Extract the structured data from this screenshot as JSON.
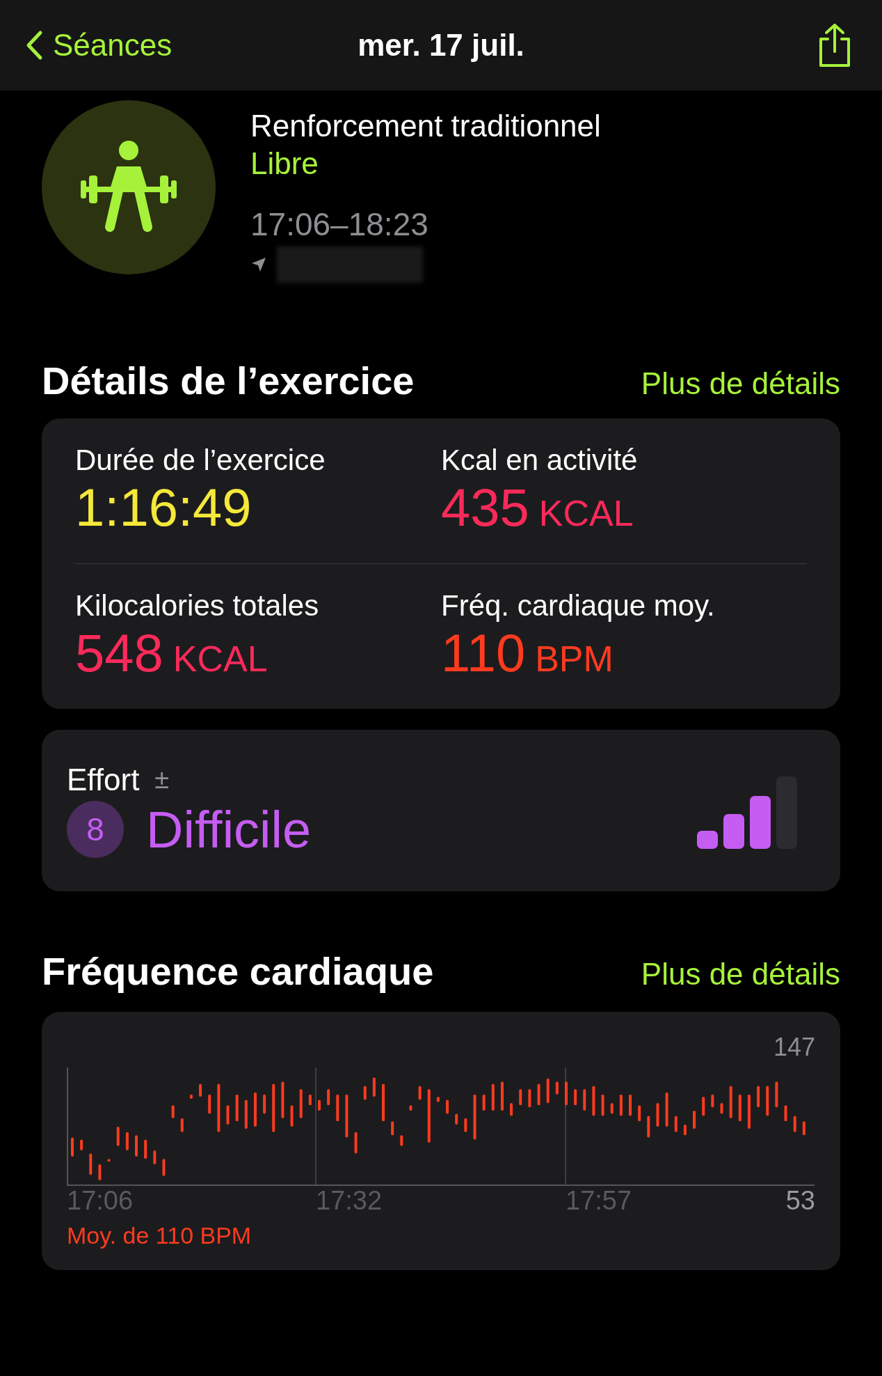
{
  "nav": {
    "back": "Séances",
    "title": "mer. 17 juil."
  },
  "workout": {
    "name": "Renforcement traditionnel",
    "type": "Libre",
    "time": "17:06–18:23"
  },
  "details": {
    "title": "Détails de l’exercice",
    "link": "Plus de détails",
    "metrics": [
      {
        "label": "Durée de l’exercice",
        "value": "1:16:49",
        "color": "#f5e83b"
      },
      {
        "label": "Kcal en activité",
        "value": "435",
        "unit": "KCAL",
        "color": "#fa2a5a"
      },
      {
        "label": "Kilocalories totales",
        "value": "548",
        "unit": "KCAL",
        "color": "#fa2a5a"
      },
      {
        "label": "Fréq. cardiaque moy.",
        "value": "110",
        "unit": "BPM",
        "color": "#ff3b1f"
      }
    ]
  },
  "effort": {
    "label": "Effort",
    "adjust": "±",
    "score": "8",
    "rating": "Difficile",
    "level": 0.75
  },
  "heart": {
    "title": "Fréquence cardiaque",
    "link": "Plus de détails",
    "y_max": "147",
    "y_min": "53",
    "x_labels": [
      "17:06",
      "17:32",
      "17:57"
    ],
    "average": "Moy. de 110 BPM"
  }
}
